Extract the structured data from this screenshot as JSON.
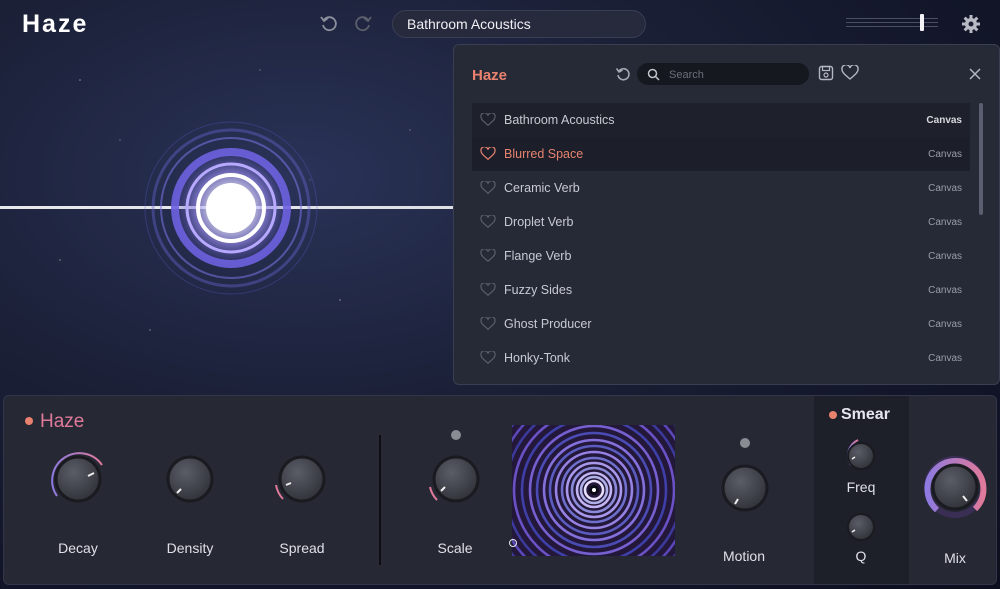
{
  "app": {
    "brand": "Haze"
  },
  "toolbar": {
    "preset_name": "Bathroom Acoustics"
  },
  "browser": {
    "title": "Haze",
    "search_placeholder": "Search",
    "presets": [
      {
        "name": "Bathroom Acoustics",
        "category": "Canvas",
        "selected": true,
        "favorite": false
      },
      {
        "name": "Blurred Space",
        "category": "Canvas",
        "highlighted": true,
        "favorite": false
      },
      {
        "name": "Ceramic Verb",
        "category": "Canvas"
      },
      {
        "name": "Droplet Verb",
        "category": "Canvas"
      },
      {
        "name": "Flange Verb",
        "category": "Canvas"
      },
      {
        "name": "Fuzzy Sides",
        "category": "Canvas"
      },
      {
        "name": "Ghost Producer",
        "category": "Canvas"
      },
      {
        "name": "Honky-Tonk",
        "category": "Canvas"
      }
    ]
  },
  "haze_module": {
    "title": "Haze",
    "knobs": {
      "decay": "Decay",
      "density": "Density",
      "spread": "Spread",
      "scale": "Scale",
      "motion": "Motion"
    }
  },
  "smear_module": {
    "title": "Smear",
    "freq": "Freq",
    "q": "Q"
  },
  "mix": {
    "label": "Mix"
  },
  "colors": {
    "accent": "#e8826f",
    "module_title": "#e07a9a",
    "purple": "#8e7ae0",
    "panel": "#262834"
  }
}
